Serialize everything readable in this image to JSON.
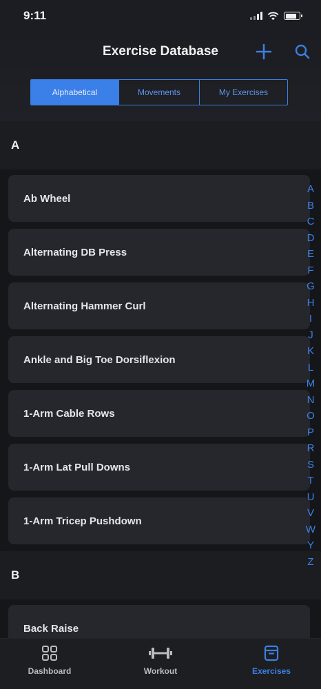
{
  "status": {
    "time": "9:11"
  },
  "header": {
    "title": "Exercise Database"
  },
  "segments": [
    "Alphabetical",
    "Movements",
    "My Exercises"
  ],
  "sections": [
    {
      "letter": "A",
      "items": [
        "Ab Wheel",
        "Alternating DB Press",
        "Alternating Hammer Curl",
        "Ankle and Big Toe Dorsiflexion",
        "1-Arm Cable Rows",
        "1-Arm Lat Pull Downs",
        "1-Arm Tricep Pushdown"
      ]
    },
    {
      "letter": "B",
      "items": [
        "Back Raise"
      ]
    }
  ],
  "index_letters": [
    "A",
    "B",
    "C",
    "D",
    "E",
    "F",
    "G",
    "H",
    "I",
    "J",
    "K",
    "L",
    "M",
    "N",
    "O",
    "P",
    "R",
    "S",
    "T",
    "U",
    "V",
    "W",
    "Y",
    "Z"
  ],
  "tabs": [
    {
      "label": "Dashboard",
      "icon": "grid-icon"
    },
    {
      "label": "Workout",
      "icon": "dumbbell-icon"
    },
    {
      "label": "Exercises",
      "icon": "archive-box-icon"
    }
  ],
  "colors": {
    "accent": "#3b7fe8",
    "background": "#151619",
    "row": "#25272c"
  }
}
